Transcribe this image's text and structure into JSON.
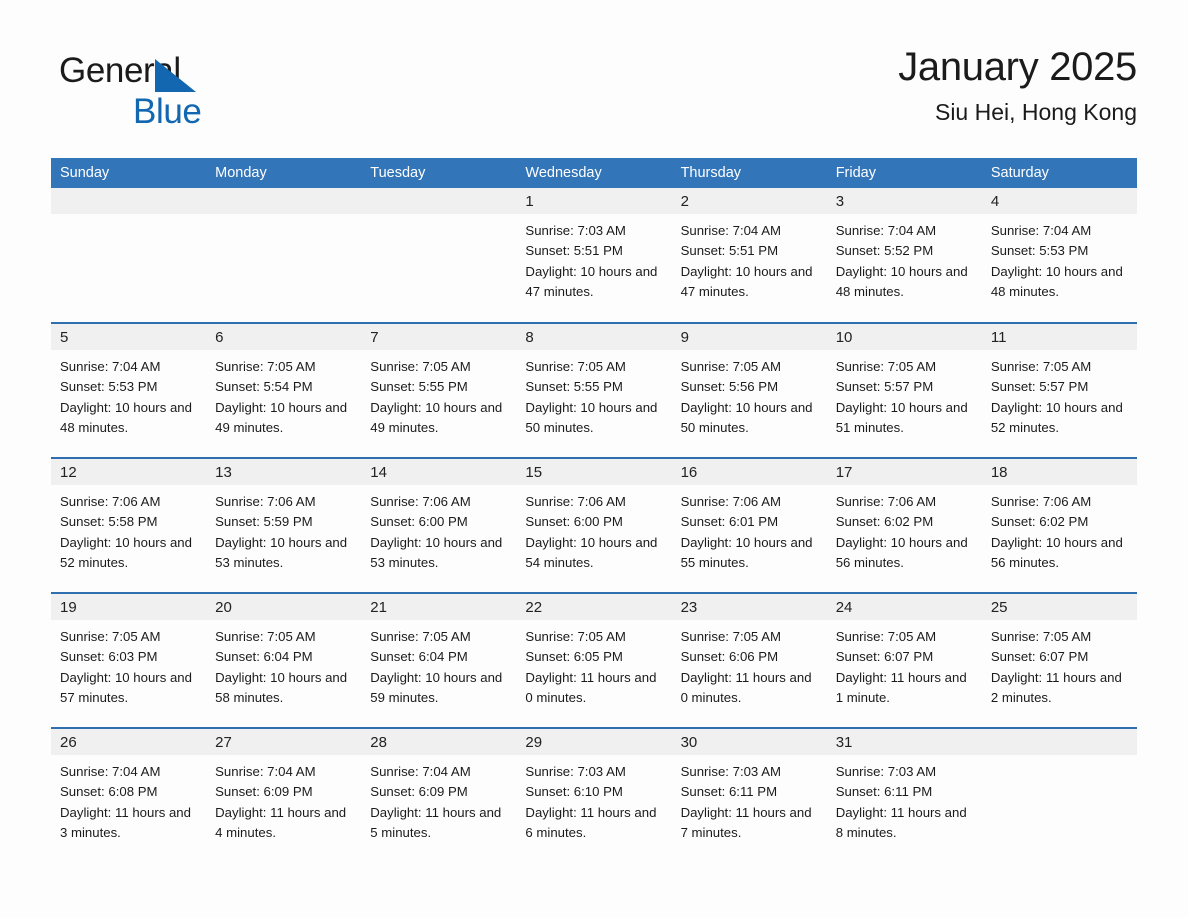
{
  "brand": {
    "name_part1": "General",
    "name_part2": "Blue",
    "triangle_color": "#1267b0"
  },
  "header": {
    "title": "January 2025",
    "subtitle": "Siu Hei, Hong Kong"
  },
  "theme": {
    "header_blue": "#3275b9",
    "row_border_blue": "#2f6fb0",
    "daynum_gray": "#f0f0f0",
    "page_bg": "#fdfdfd",
    "text": "#1b1b1b"
  },
  "calendar": {
    "weekday_headers": [
      "Sunday",
      "Monday",
      "Tuesday",
      "Wednesday",
      "Thursday",
      "Friday",
      "Saturday"
    ],
    "weeks": [
      [
        {
          "day": "",
          "empty": true
        },
        {
          "day": "",
          "empty": true
        },
        {
          "day": "",
          "empty": true
        },
        {
          "day": "1",
          "sunrise": "Sunrise: 7:03 AM",
          "sunset": "Sunset: 5:51 PM",
          "daylight": "Daylight: 10 hours and 47 minutes."
        },
        {
          "day": "2",
          "sunrise": "Sunrise: 7:04 AM",
          "sunset": "Sunset: 5:51 PM",
          "daylight": "Daylight: 10 hours and 47 minutes."
        },
        {
          "day": "3",
          "sunrise": "Sunrise: 7:04 AM",
          "sunset": "Sunset: 5:52 PM",
          "daylight": "Daylight: 10 hours and 48 minutes."
        },
        {
          "day": "4",
          "sunrise": "Sunrise: 7:04 AM",
          "sunset": "Sunset: 5:53 PM",
          "daylight": "Daylight: 10 hours and 48 minutes."
        }
      ],
      [
        {
          "day": "5",
          "sunrise": "Sunrise: 7:04 AM",
          "sunset": "Sunset: 5:53 PM",
          "daylight": "Daylight: 10 hours and 48 minutes."
        },
        {
          "day": "6",
          "sunrise": "Sunrise: 7:05 AM",
          "sunset": "Sunset: 5:54 PM",
          "daylight": "Daylight: 10 hours and 49 minutes."
        },
        {
          "day": "7",
          "sunrise": "Sunrise: 7:05 AM",
          "sunset": "Sunset: 5:55 PM",
          "daylight": "Daylight: 10 hours and 49 minutes."
        },
        {
          "day": "8",
          "sunrise": "Sunrise: 7:05 AM",
          "sunset": "Sunset: 5:55 PM",
          "daylight": "Daylight: 10 hours and 50 minutes."
        },
        {
          "day": "9",
          "sunrise": "Sunrise: 7:05 AM",
          "sunset": "Sunset: 5:56 PM",
          "daylight": "Daylight: 10 hours and 50 minutes."
        },
        {
          "day": "10",
          "sunrise": "Sunrise: 7:05 AM",
          "sunset": "Sunset: 5:57 PM",
          "daylight": "Daylight: 10 hours and 51 minutes."
        },
        {
          "day": "11",
          "sunrise": "Sunrise: 7:05 AM",
          "sunset": "Sunset: 5:57 PM",
          "daylight": "Daylight: 10 hours and 52 minutes."
        }
      ],
      [
        {
          "day": "12",
          "sunrise": "Sunrise: 7:06 AM",
          "sunset": "Sunset: 5:58 PM",
          "daylight": "Daylight: 10 hours and 52 minutes."
        },
        {
          "day": "13",
          "sunrise": "Sunrise: 7:06 AM",
          "sunset": "Sunset: 5:59 PM",
          "daylight": "Daylight: 10 hours and 53 minutes."
        },
        {
          "day": "14",
          "sunrise": "Sunrise: 7:06 AM",
          "sunset": "Sunset: 6:00 PM",
          "daylight": "Daylight: 10 hours and 53 minutes."
        },
        {
          "day": "15",
          "sunrise": "Sunrise: 7:06 AM",
          "sunset": "Sunset: 6:00 PM",
          "daylight": "Daylight: 10 hours and 54 minutes."
        },
        {
          "day": "16",
          "sunrise": "Sunrise: 7:06 AM",
          "sunset": "Sunset: 6:01 PM",
          "daylight": "Daylight: 10 hours and 55 minutes."
        },
        {
          "day": "17",
          "sunrise": "Sunrise: 7:06 AM",
          "sunset": "Sunset: 6:02 PM",
          "daylight": "Daylight: 10 hours and 56 minutes."
        },
        {
          "day": "18",
          "sunrise": "Sunrise: 7:06 AM",
          "sunset": "Sunset: 6:02 PM",
          "daylight": "Daylight: 10 hours and 56 minutes."
        }
      ],
      [
        {
          "day": "19",
          "sunrise": "Sunrise: 7:05 AM",
          "sunset": "Sunset: 6:03 PM",
          "daylight": "Daylight: 10 hours and 57 minutes."
        },
        {
          "day": "20",
          "sunrise": "Sunrise: 7:05 AM",
          "sunset": "Sunset: 6:04 PM",
          "daylight": "Daylight: 10 hours and 58 minutes."
        },
        {
          "day": "21",
          "sunrise": "Sunrise: 7:05 AM",
          "sunset": "Sunset: 6:04 PM",
          "daylight": "Daylight: 10 hours and 59 minutes."
        },
        {
          "day": "22",
          "sunrise": "Sunrise: 7:05 AM",
          "sunset": "Sunset: 6:05 PM",
          "daylight": "Daylight: 11 hours and 0 minutes."
        },
        {
          "day": "23",
          "sunrise": "Sunrise: 7:05 AM",
          "sunset": "Sunset: 6:06 PM",
          "daylight": "Daylight: 11 hours and 0 minutes."
        },
        {
          "day": "24",
          "sunrise": "Sunrise: 7:05 AM",
          "sunset": "Sunset: 6:07 PM",
          "daylight": "Daylight: 11 hours and 1 minute."
        },
        {
          "day": "25",
          "sunrise": "Sunrise: 7:05 AM",
          "sunset": "Sunset: 6:07 PM",
          "daylight": "Daylight: 11 hours and 2 minutes."
        }
      ],
      [
        {
          "day": "26",
          "sunrise": "Sunrise: 7:04 AM",
          "sunset": "Sunset: 6:08 PM",
          "daylight": "Daylight: 11 hours and 3 minutes."
        },
        {
          "day": "27",
          "sunrise": "Sunrise: 7:04 AM",
          "sunset": "Sunset: 6:09 PM",
          "daylight": "Daylight: 11 hours and 4 minutes."
        },
        {
          "day": "28",
          "sunrise": "Sunrise: 7:04 AM",
          "sunset": "Sunset: 6:09 PM",
          "daylight": "Daylight: 11 hours and 5 minutes."
        },
        {
          "day": "29",
          "sunrise": "Sunrise: 7:03 AM",
          "sunset": "Sunset: 6:10 PM",
          "daylight": "Daylight: 11 hours and 6 minutes."
        },
        {
          "day": "30",
          "sunrise": "Sunrise: 7:03 AM",
          "sunset": "Sunset: 6:11 PM",
          "daylight": "Daylight: 11 hours and 7 minutes."
        },
        {
          "day": "31",
          "sunrise": "Sunrise: 7:03 AM",
          "sunset": "Sunset: 6:11 PM",
          "daylight": "Daylight: 11 hours and 8 minutes."
        },
        {
          "day": "",
          "empty": true
        }
      ]
    ]
  }
}
